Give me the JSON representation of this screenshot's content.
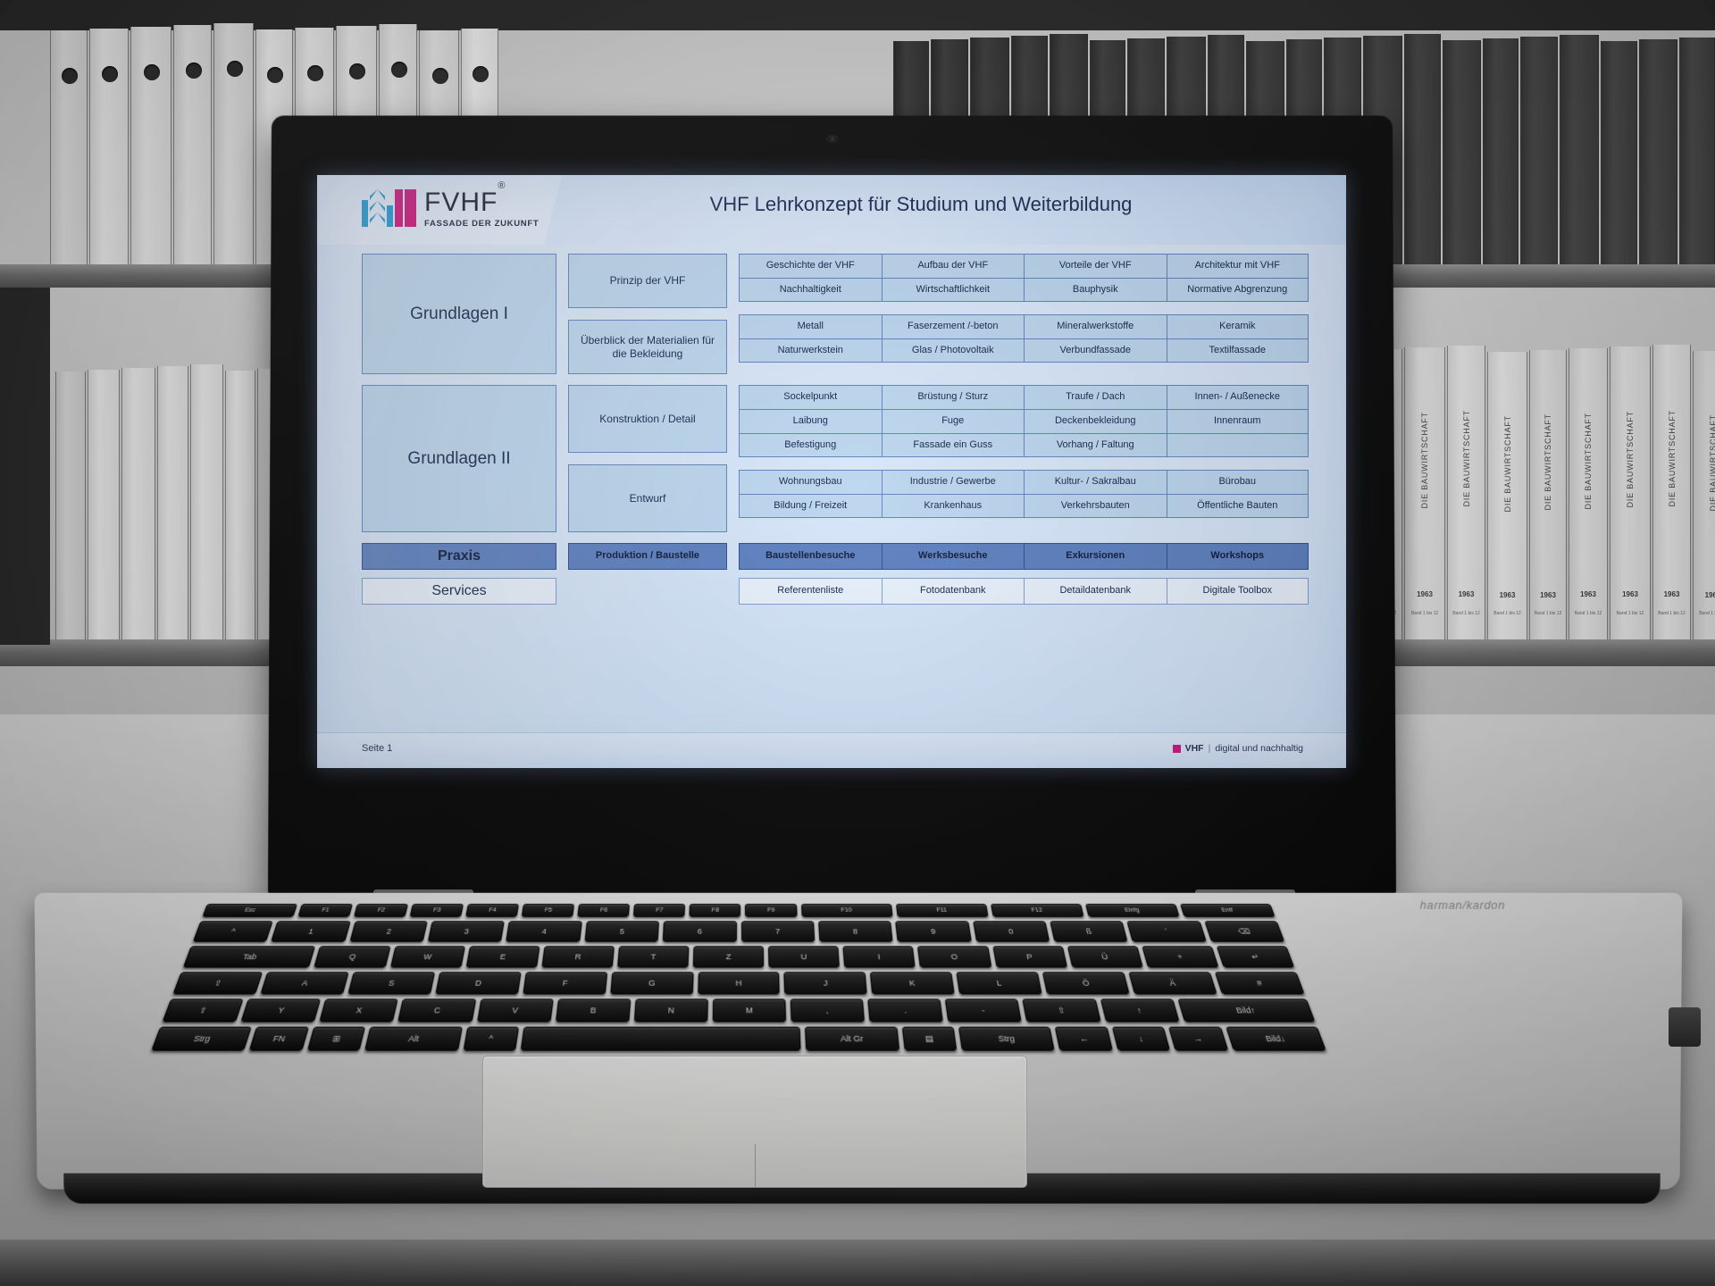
{
  "scene": {
    "background_books_label": "DIE BAUWIRTSCHAFT",
    "background_books_year": "1963",
    "background_books_sub": "Band 1 bis 12",
    "laptop_brand_text": "harman/kardon"
  },
  "slide": {
    "title": "VHF Lehrkonzept für Studium und Weiterbildung",
    "logo": {
      "name": "FVHF",
      "registered": "®",
      "tagline": "FASSADE DER ZUKUNFT"
    },
    "colors": {
      "brand_magenta": "#cf0f7b",
      "brand_blue": "#1e9ad6",
      "box_fill": "#bcd6ef",
      "box_border": "#5d86bd",
      "highlight_fill": "#5c7fc0",
      "text": "#14264b"
    },
    "sections": [
      {
        "name": "Grundlagen I",
        "label": "Grundlagen I",
        "modules": [
          {
            "label": "Prinzip der VHF",
            "topics": [
              "Geschichte der VHF",
              "Aufbau der VHF",
              "Vorteile der VHF",
              "Architektur mit VHF",
              "Nachhaltigkeit",
              "Wirtschaftlichkeit",
              "Bauphysik",
              "Normative Abgrenzung"
            ]
          },
          {
            "label": "Überblick der Materialien für die Bekleidung",
            "topics": [
              "Metall",
              "Faserzement /-beton",
              "Mineralwerkstoffe",
              "Keramik",
              "Naturwerkstein",
              "Glas / Photovoltaik",
              "Verbundfassade",
              "Textilfassade"
            ]
          }
        ]
      },
      {
        "name": "Grundlagen II",
        "label": "Grundlagen II",
        "modules": [
          {
            "label": "Konstruktion / Detail",
            "topics": [
              "Sockelpunkt",
              "Brüstung / Sturz",
              "Traufe / Dach",
              "Innen- / Außenecke",
              "Laibung",
              "Fuge",
              "Deckenbekleidung",
              "Innenraum",
              "Befestigung",
              "Fassade ein Guss",
              "Vorhang / Faltung",
              ""
            ]
          },
          {
            "label": "Entwurf",
            "topics": [
              "Wohnungsbau",
              "Industrie / Gewerbe",
              "Kultur- / Sakralbau",
              "Bürobau",
              "Bildung / Freizeit",
              "Krankenhaus",
              "Verkehrsbauten",
              "Öffentliche Bauten"
            ]
          }
        ]
      }
    ],
    "praxis_row": {
      "label": "Praxis",
      "module": "Produktion / Baustelle",
      "topics": [
        "Baustellenbesuche",
        "Werksbesuche",
        "Exkursionen",
        "Workshops"
      ]
    },
    "services_row": {
      "label": "Services",
      "module": "",
      "topics": [
        "Referentenliste",
        "Fotodatenbank",
        "Detaildatenbank",
        "Digitale Toolbox"
      ]
    },
    "footer": {
      "page": "Seite 1",
      "brand": "VHF",
      "separator": "|",
      "claim": "digital und nachhaltig"
    }
  },
  "keyboard": {
    "fn_row": [
      "Esc",
      "F1",
      "F2",
      "F3",
      "F4",
      "F5",
      "F6",
      "F7",
      "F8",
      "F9",
      "F10",
      "F11",
      "F12",
      "Einfg",
      "Entf"
    ],
    "num_row": [
      "^",
      "1",
      "2",
      "3",
      "4",
      "5",
      "6",
      "7",
      "8",
      "9",
      "0",
      "ß",
      "´",
      "⌫"
    ],
    "row_q": [
      "Tab",
      "Q",
      "W",
      "E",
      "R",
      "T",
      "Z",
      "U",
      "I",
      "O",
      "P",
      "Ü",
      "+",
      "↵"
    ],
    "row_a": [
      "⇪",
      "A",
      "S",
      "D",
      "F",
      "G",
      "H",
      "J",
      "K",
      "L",
      "Ö",
      "Ä",
      "#"
    ],
    "row_y": [
      "⇧",
      "Y",
      "X",
      "C",
      "V",
      "B",
      "N",
      "M",
      ",",
      ".",
      "-",
      "⇧",
      "↑",
      "Bild↑"
    ],
    "row_space": [
      "Strg",
      "FN",
      "⊞",
      "Alt",
      "^",
      "",
      "Alt Gr",
      "▤",
      "Strg",
      "←",
      "↓",
      "→",
      "Bild↓"
    ]
  }
}
